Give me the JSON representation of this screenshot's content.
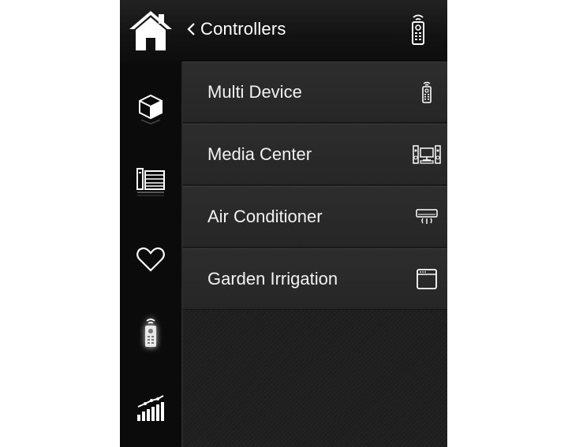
{
  "header": {
    "back_label": "Controllers",
    "icons": {
      "home": "home-icon",
      "remote": "remote-icon"
    }
  },
  "sidebar": {
    "items": [
      {
        "icon": "cube-icon",
        "active": false
      },
      {
        "icon": "library-icon",
        "active": false
      },
      {
        "icon": "heart-icon",
        "active": false
      },
      {
        "icon": "remote-icon",
        "active": true
      },
      {
        "icon": "stats-icon",
        "active": false
      }
    ]
  },
  "list": {
    "items": [
      {
        "label": "Multi Device",
        "icon": "remote-icon"
      },
      {
        "label": "Media Center",
        "icon": "media-center-icon"
      },
      {
        "label": "Air Conditioner",
        "icon": "air-conditioner-icon"
      },
      {
        "label": "Garden Irrigation",
        "icon": "window-icon"
      }
    ]
  },
  "colors": {
    "background": "#1b1b1b",
    "sidebar": "#0b0b0b",
    "text": "#f2f2f2",
    "icon": "#ffffff"
  }
}
